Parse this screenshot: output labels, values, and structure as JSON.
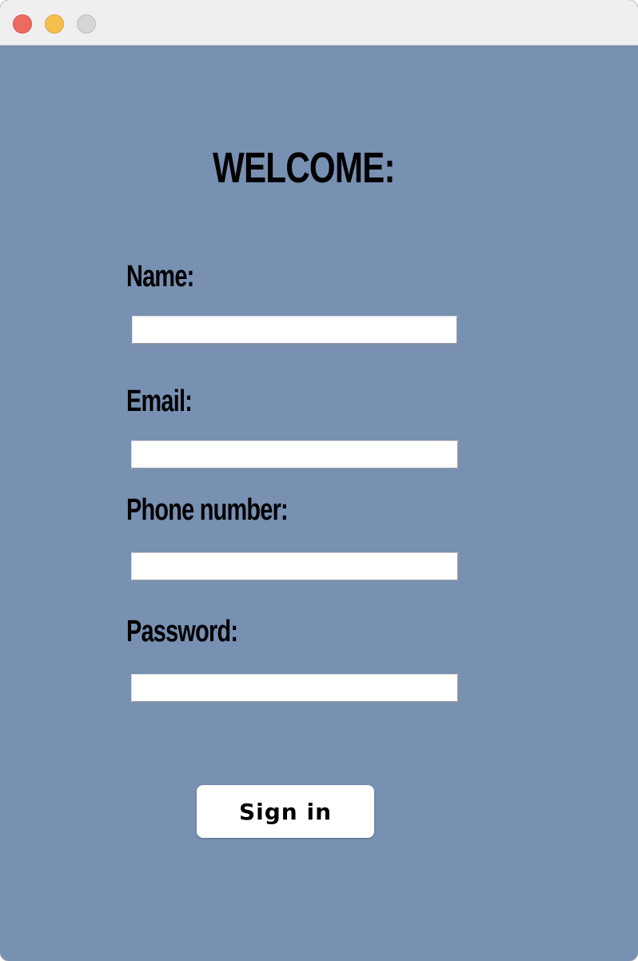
{
  "window": {
    "controls": {
      "close_color": "#ee6a5f",
      "minimize_color": "#f5be4f",
      "zoom_color": "#d6d6d6"
    },
    "background_color": "#7890b2"
  },
  "form": {
    "title": "WELCOME:",
    "fields": [
      {
        "label": "Name:",
        "value": "",
        "placeholder": ""
      },
      {
        "label": "Email:",
        "value": "",
        "placeholder": ""
      },
      {
        "label": "Phone number:",
        "value": "",
        "placeholder": ""
      },
      {
        "label": "Password:",
        "value": "",
        "placeholder": ""
      }
    ],
    "submit_label": "Sign in"
  }
}
